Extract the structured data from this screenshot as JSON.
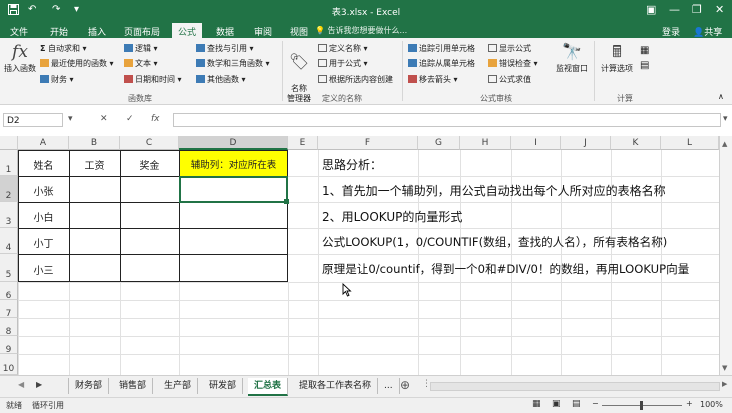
{
  "window": {
    "title": "表3.xlsx - Excel",
    "save_icon": "floppy",
    "undo_icon": "↶",
    "redo_icon": "↷"
  },
  "ribbon_tabs": [
    "文件",
    "开始",
    "插入",
    "页面布局",
    "公式",
    "数据",
    "审阅",
    "视图"
  ],
  "active_tab": "公式",
  "tell_me": "告诉我您想要做什么...",
  "account": {
    "login": "登录",
    "share": "共享"
  },
  "ribbon": {
    "insert_function": "插入函数",
    "fx_glyph": "fx",
    "library": {
      "autosum": "自动求和",
      "recent": "最近使用的函数",
      "financial": "财务",
      "logical": "逻辑",
      "text": "文本",
      "datetime": "日期和时间",
      "lookup": "查找与引用",
      "math": "数学和三角函数",
      "other": "其他函数",
      "label": "函数库"
    },
    "names": {
      "manager": "名称\n管理器",
      "define": "定义名称",
      "use_in_formula": "用于公式",
      "create_from_selection": "根据所选内容创建",
      "label": "定义的名称"
    },
    "audit": {
      "trace_precedents": "追踪引用单元格",
      "trace_dependents": "追踪从属单元格",
      "remove_arrows": "移去箭头",
      "show_formulas": "显示公式",
      "error_checking": "错误检查",
      "evaluate": "公式求值",
      "watch": "监视窗口",
      "label": "公式审核"
    },
    "calc": {
      "options": "计算选项",
      "label": "计算"
    }
  },
  "formula_bar": {
    "name_box": "D2",
    "cancel": "✕",
    "enter": "✓",
    "fx": "fx",
    "value": ""
  },
  "columns": [
    "A",
    "B",
    "C",
    "D",
    "E",
    "F",
    "G",
    "H",
    "I",
    "J",
    "K",
    "L"
  ],
  "rows": [
    "1",
    "2",
    "3",
    "4",
    "5",
    "6",
    "7",
    "8",
    "9",
    "10"
  ],
  "table": {
    "headers": [
      "姓名",
      "工资",
      "奖金",
      "辅助列：对应所在表"
    ],
    "names": [
      "小张",
      "小白",
      "小丁",
      "小三"
    ]
  },
  "notes": [
    "思路分析：",
    "1、首先加一个辅助列，用公式自动找出每个人所对应的表格名称",
    "2、用LOOKUP的向量形式",
    "公式LOOKUP(1，0/COUNTIF(数组，查找的人名），所有表格名称)",
    "原理是让0/countif，得到一个0和#DIV/0！的数组，再用LOOKUP向量"
  ],
  "sheets": [
    "财务部",
    "销售部",
    "生产部",
    "研发部",
    "汇总表",
    "提取各工作表名称"
  ],
  "active_sheet": "汇总表",
  "sheet_more": "...",
  "status": {
    "mode": "就绪",
    "message": "循环引用",
    "zoom": "100%",
    "zoom_minus": "−",
    "zoom_plus": "+"
  },
  "colors": {
    "excel_green": "#217346",
    "helper_header_fill": "#ffff00"
  }
}
